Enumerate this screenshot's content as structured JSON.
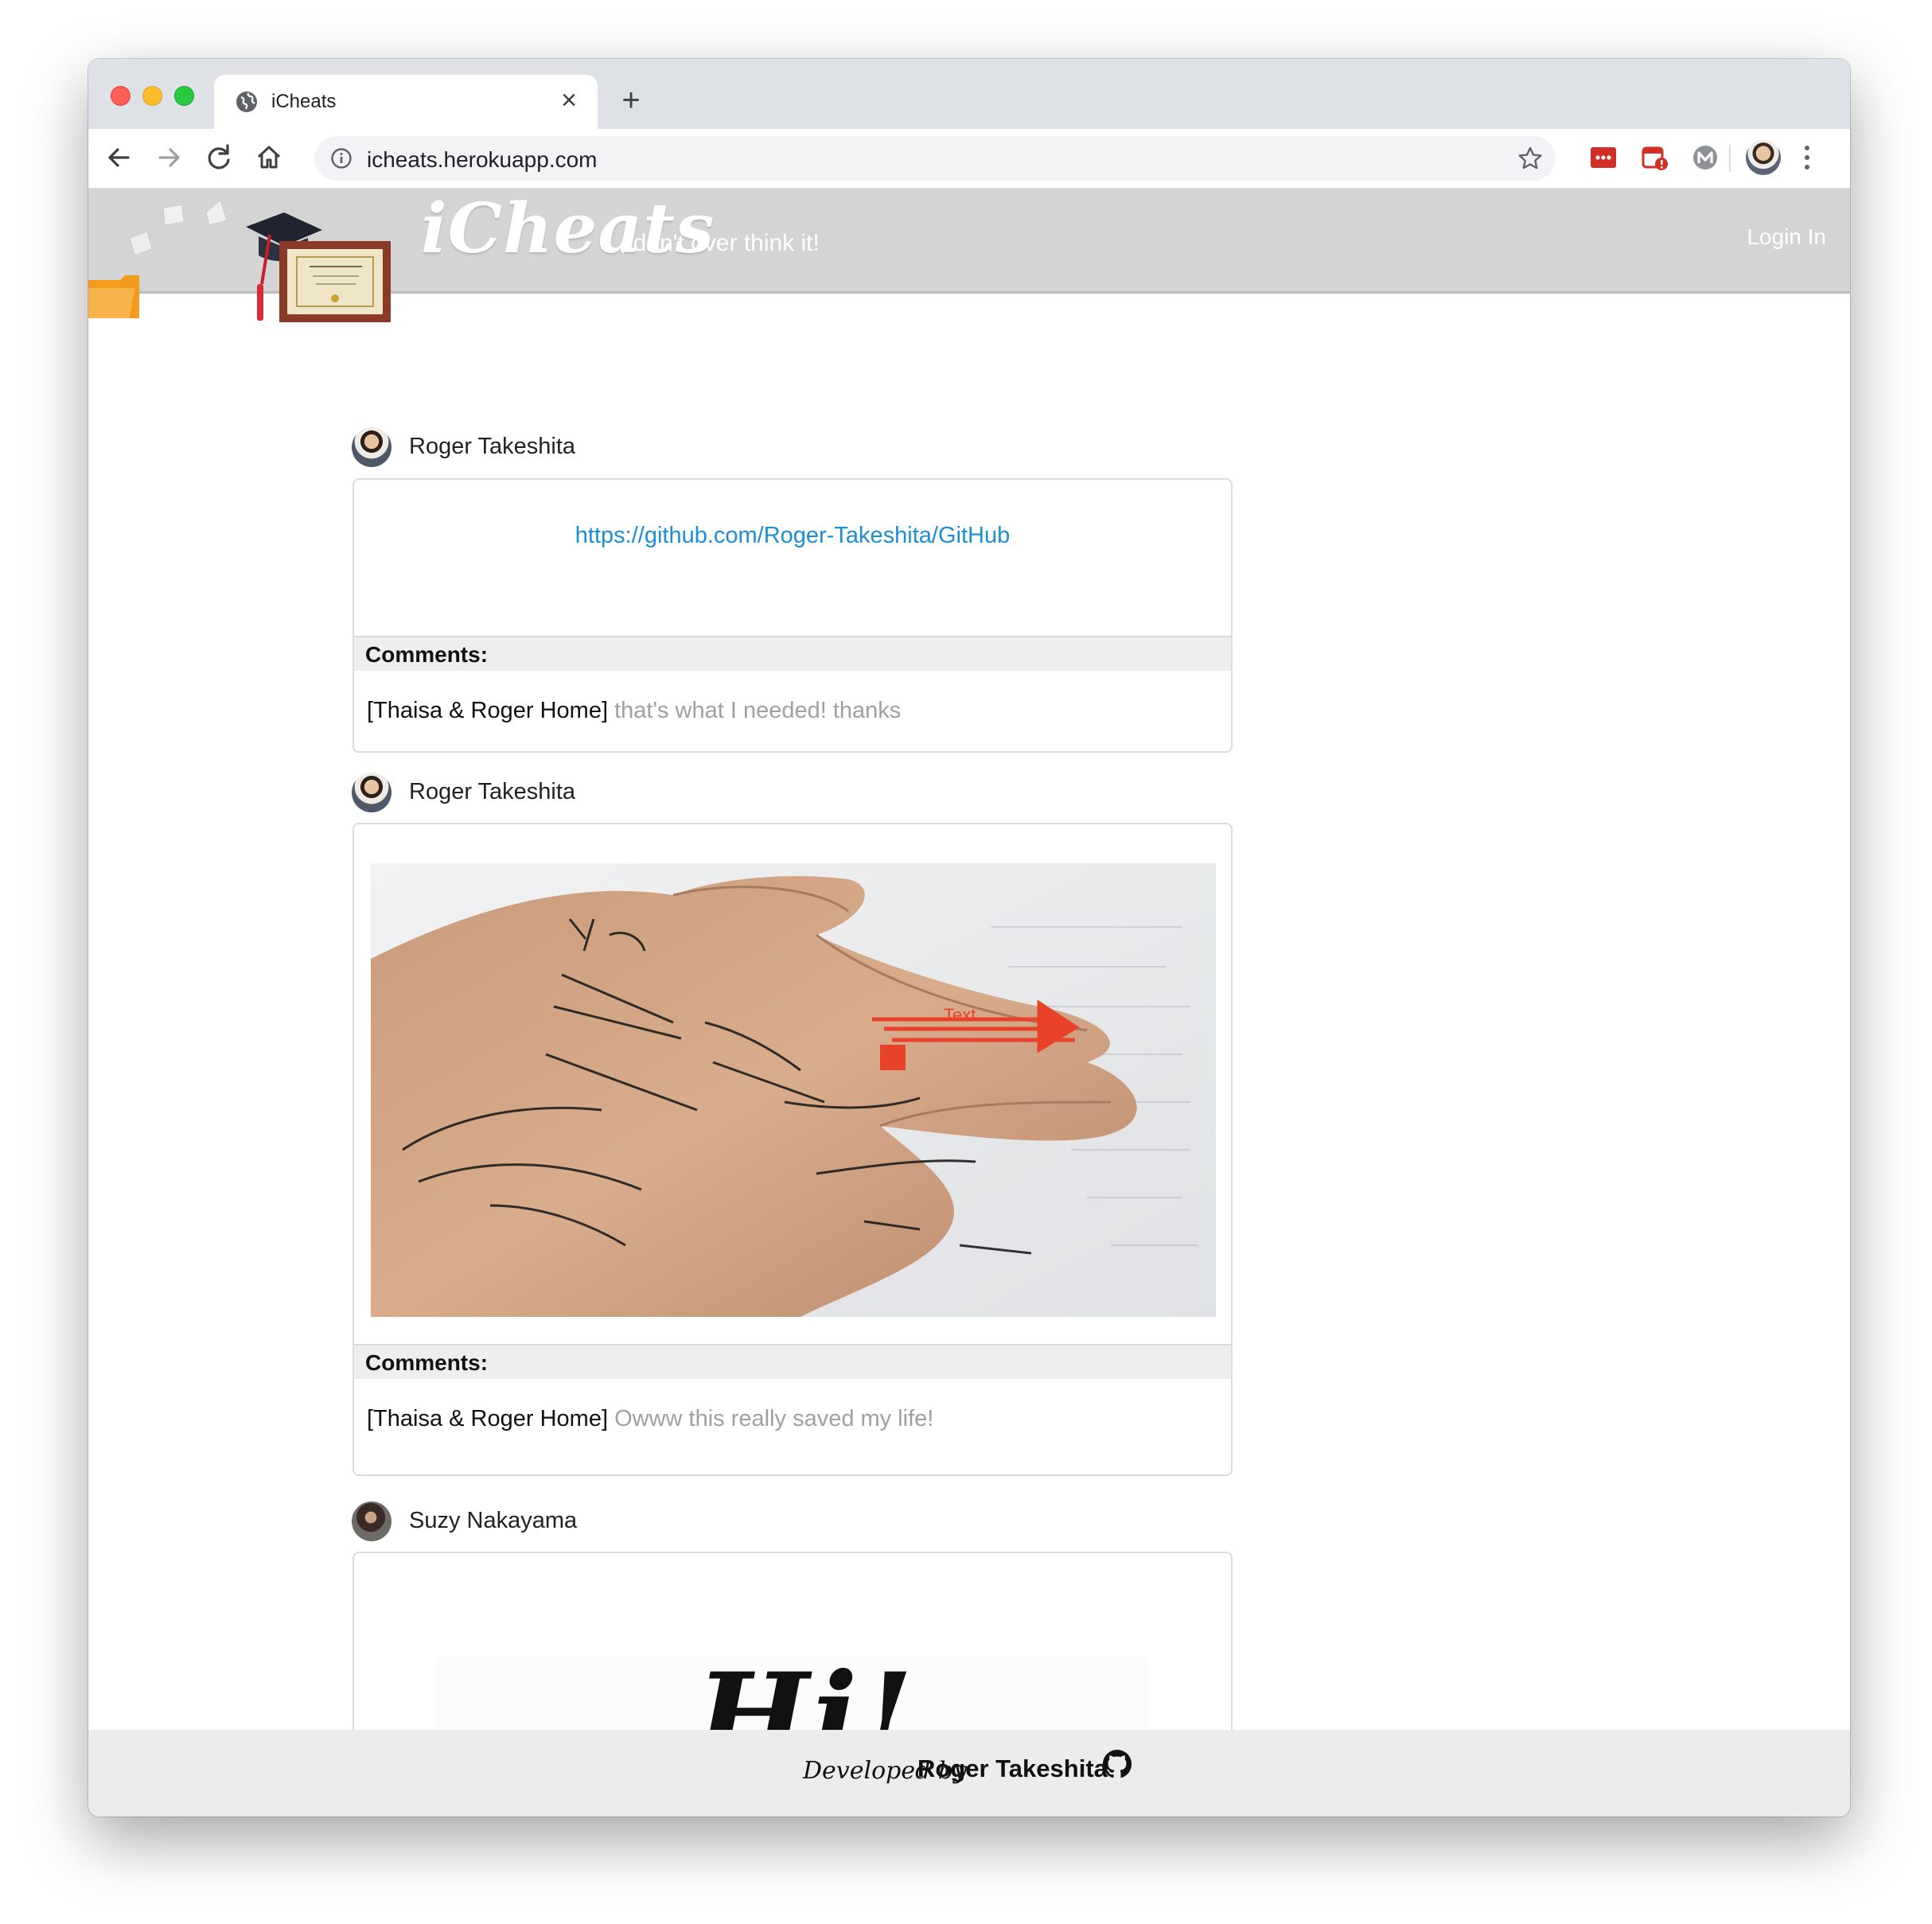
{
  "browser": {
    "tab_title": "iCheats",
    "tab_close_glyph": "×",
    "new_tab_glyph": "+",
    "url": "icheats.herokuapp.com",
    "icons": [
      "back-icon",
      "forward-icon",
      "reload-icon",
      "home-icon",
      "site-info-icon",
      "bookmark-star-icon",
      "lastpass-extension-icon",
      "calendar-extension-icon",
      "m-extension-icon",
      "profile-avatar",
      "menu-kebab-icon"
    ]
  },
  "site": {
    "brand": "iCheats",
    "tagline": ", don't over think it!",
    "login_label": "Login In",
    "colors": {
      "header_bg": "#d4d4d4",
      "link": "#1a8fd6",
      "comment_text": "#a0a0a0",
      "footer_bg": "#ececec",
      "arrow": "#e8422a"
    }
  },
  "posts": [
    {
      "author": "Roger Takeshita",
      "link": "https://github.com/Roger-Takeshita/GitHub",
      "comments_label": "Comments:",
      "comments": [
        {
          "author": "[Thaisa & Roger Home]",
          "text": "that's what I needed! thanks"
        }
      ]
    },
    {
      "author": "Roger Takeshita",
      "image": "hand-with-math-formulas-photo",
      "image_annotation": "Text",
      "comments_label": "Comments:",
      "comments": [
        {
          "author": "[Thaisa & Roger Home]",
          "text": "Owww this really saved my life!"
        }
      ]
    },
    {
      "author": "Suzy Nakayama",
      "image_text": "Hi!"
    }
  ],
  "footer": {
    "developed_by": "Developed by",
    "name": "Roger Takeshita",
    "icon": "github-icon"
  }
}
